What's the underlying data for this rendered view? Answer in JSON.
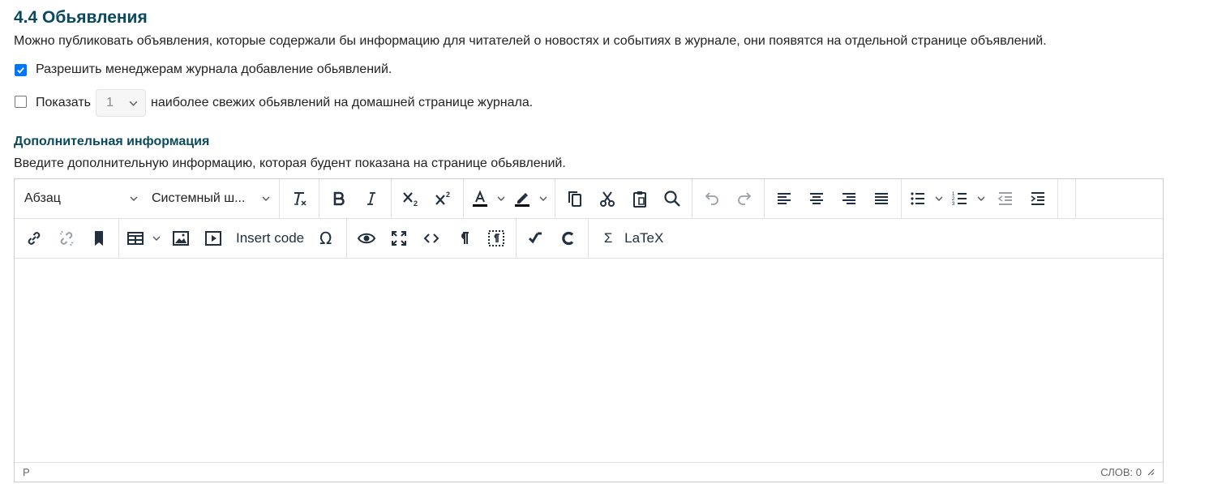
{
  "section": {
    "title": "4.4 Обьявления",
    "description": "Можно публиковать объявления, которые содержали бы информацию для читателей о новостях и событиях в журнале, они появятся на отдельной странице объявлений."
  },
  "options": {
    "allow_managers": {
      "label": "Разрешить менеджерам журнала добавление обьявлений.",
      "checked": true
    },
    "show_recent": {
      "prefix": "Показать",
      "count_value": "1",
      "suffix": "наиболее свежих обьявлений на домашней странице журнала.",
      "checked": false
    }
  },
  "additional": {
    "title": "Дополнительная информация",
    "description": "Введите дополнительную информацию, которая будент показана на странице обьявлений."
  },
  "editor": {
    "blocks_dropdown": "Абзац",
    "font_dropdown": "Системный ш...",
    "insert_code_label": "Insert code",
    "sigma_label": "Σ",
    "latex_label": "LaTeX",
    "status_path": "P",
    "word_count": "СЛОВ: 0"
  },
  "colors": {
    "heading": "#0a4a5e",
    "checkbox_checked": "#0075ff",
    "icon": "#222f3e"
  }
}
